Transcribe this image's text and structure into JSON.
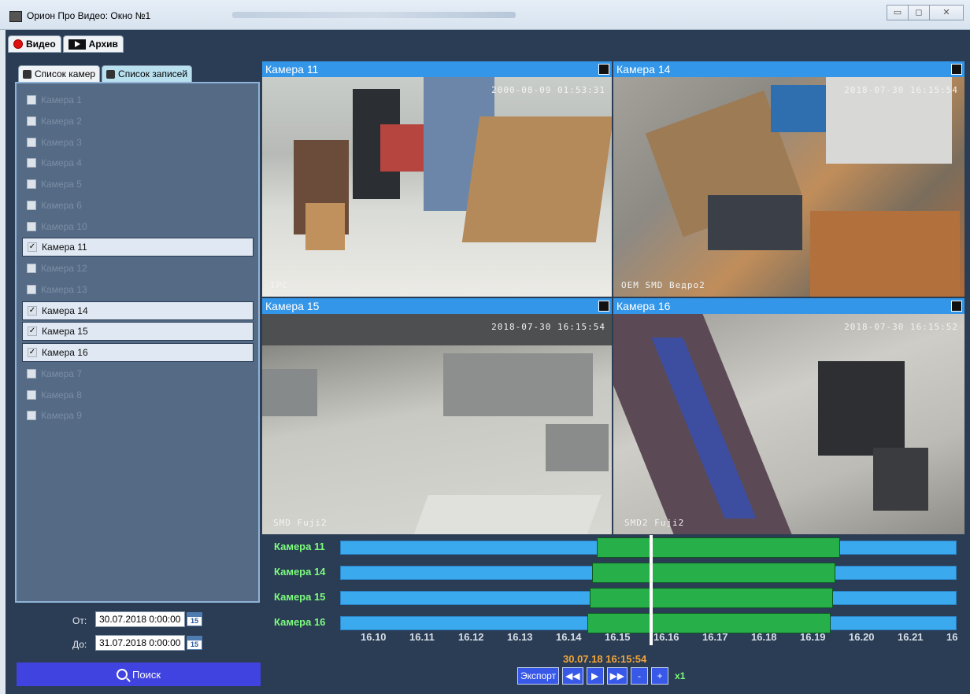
{
  "window": {
    "title": "Орион Про Видео: Окно №1",
    "min_glyph": "▭",
    "max_glyph": "◻",
    "close_glyph": "✕"
  },
  "main_tabs": [
    {
      "label": "Видео",
      "icon": "red-dot-icon"
    },
    {
      "label": "Архив",
      "icon": "film-icon"
    }
  ],
  "sub_tabs": [
    {
      "label": "Список камер",
      "icon": "camera-icon"
    },
    {
      "label": "Список записей",
      "icon": "records-icon"
    }
  ],
  "camera_list": [
    {
      "label": "Камера 1",
      "checked": false
    },
    {
      "label": "Камера 2",
      "checked": false
    },
    {
      "label": "Камера 3",
      "checked": false
    },
    {
      "label": "Камера 4",
      "checked": false
    },
    {
      "label": "Камера 5",
      "checked": false
    },
    {
      "label": "Камера 6",
      "checked": false
    },
    {
      "label": "Камера 10",
      "checked": false
    },
    {
      "label": "Камера 11",
      "checked": true
    },
    {
      "label": "Камера 12",
      "checked": false
    },
    {
      "label": "Камера 13",
      "checked": false
    },
    {
      "label": "Камера 14",
      "checked": true
    },
    {
      "label": "Камера 15",
      "checked": true
    },
    {
      "label": "Камера 16",
      "checked": true
    },
    {
      "label": "Камера 7",
      "checked": false
    },
    {
      "label": "Камера 8",
      "checked": false
    },
    {
      "label": "Камера 9",
      "checked": false
    }
  ],
  "date_from": {
    "label": "От:",
    "value": "30.07.2018 0:00:00",
    "cal": "15"
  },
  "date_to": {
    "label": "До:",
    "value": "31.07.2018 0:00:00",
    "cal": "15"
  },
  "search_button": "Поиск",
  "views": [
    {
      "title": "Камера 11",
      "stamp": "2000-08-09 01:53:31",
      "caption": "IPC"
    },
    {
      "title": "Камера 14",
      "stamp": "2018-07-30 16:15:54",
      "caption": "OEM SMD Ведро2"
    },
    {
      "title": "Камера 15",
      "stamp": "2018-07-30 16:15:54",
      "caption": "SMD Fuji2"
    },
    {
      "title": "Камера 16",
      "stamp": "2018-07-30 16:15:52",
      "caption": "SMD2 Fuji2"
    }
  ],
  "timeline": {
    "rows": [
      {
        "name": "Камера 11",
        "rec_start": 16.151,
        "rec_end": 16.201
      },
      {
        "name": "Камера 14",
        "rec_start": 16.15,
        "rec_end": 16.2
      },
      {
        "name": "Камера 15",
        "rec_start": 16.1495,
        "rec_end": 16.1995
      },
      {
        "name": "Камера 16",
        "rec_start": 16.149,
        "rec_end": 16.199
      }
    ],
    "ticks": [
      "16.10",
      "16.11",
      "16.12",
      "16.13",
      "16.14",
      "16.15",
      "16.16",
      "16.17",
      "16.18",
      "16.19",
      "16.20",
      "16.21",
      "16"
    ],
    "current_time": "30.07.18 16:15:54"
  },
  "controls": {
    "export": "Экспорт",
    "rewind": "◀◀",
    "play": "▶",
    "forward": "▶▶",
    "minus": "-",
    "plus": "+",
    "speed": "x1"
  }
}
